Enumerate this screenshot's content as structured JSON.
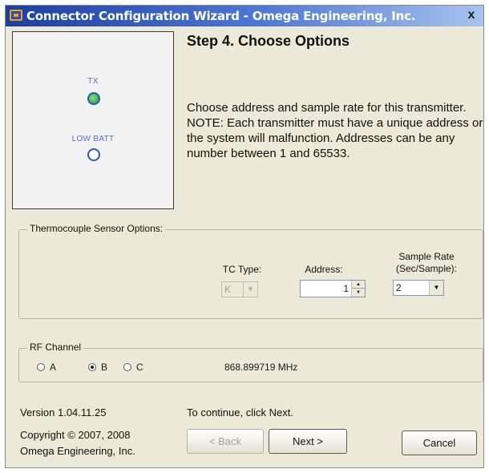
{
  "window": {
    "title": "Connector Configuration Wizard - Omega Engineering, Inc.",
    "close_label": "x"
  },
  "leds": {
    "tx_label": "TX",
    "batt_label": "LOW BATT"
  },
  "step": {
    "title": "Step 4.  Choose Options",
    "description": "Choose address and sample rate for this transmitter.  NOTE: Each transmitter must have a unique address or the system will malfunction.  Addresses can be any number between 1 and 65533."
  },
  "sensor_options": {
    "group_label": "Thermocouple Sensor Options:",
    "tc_type_label": "TC Type:",
    "tc_type_value": "K",
    "address_label": "Address:",
    "address_value": "1",
    "sample_rate_label_line1": "Sample Rate",
    "sample_rate_label_line2": "(Sec/Sample):",
    "sample_rate_value": "2"
  },
  "rf": {
    "group_label": "RF Channel",
    "options": [
      "A",
      "B",
      "C"
    ],
    "selected": "B",
    "frequency": "868.899719 MHz"
  },
  "footer": {
    "version": "Version 1.04.11.25",
    "continue_hint": "To continue, click Next.",
    "copyright_line1": "Copyright © 2007, 2008",
    "copyright_line2": "Omega Engineering, Inc.",
    "back_label": "< Back",
    "next_label": "Next >",
    "cancel_label": "Cancel"
  }
}
